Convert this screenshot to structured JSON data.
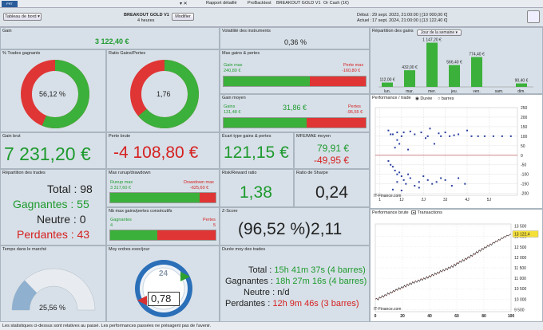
{
  "topbar": {
    "tab1": "Rapport détaillé",
    "tab2": "ProBacktest",
    "tab3": "BREAKOUT  GOLD V1",
    "tab4": "Or Cash (1€)"
  },
  "header": {
    "dropdown": "Tableau de bord",
    "strategy": "BREAKOUT  GOLD V1",
    "timeframe": "4 heures",
    "modify": "Modifier",
    "start_label": "Début :",
    "start_value": "29 sept. 2023, 21:00:00 | [10 000,00 €]",
    "end_label": "Actuel :",
    "end_value": "17 sept. 2024, 21:00:00 | [13 122,40 €]"
  },
  "gain": {
    "title": "Gain",
    "value": "3 122,40 €"
  },
  "volatility": {
    "title": "Volatilité des instruments",
    "value": "0,36 %"
  },
  "pct_winning": {
    "title": "% Trades gagnants",
    "value": "56,12 %",
    "fraction": 0.5612
  },
  "ratio_gl": {
    "title": "Ratio Gains/Pertes",
    "value": "1,76",
    "fraction": 0.6377
  },
  "max_gl": {
    "title": "Max gains & pertes",
    "gain_label": "Gain max",
    "gain_value": "240,80 €",
    "loss_label": "Perte max",
    "loss_value": "-160,80 €"
  },
  "avg_gain": {
    "title": "Gain moyen",
    "value": "31,86 €",
    "gains_label": "Gains",
    "gains_value": "131,48 €",
    "losses_label": "Pertes",
    "losses_value": "-95,55 €"
  },
  "gross_gain": {
    "title": "Gain brut",
    "value": "7 231,20 €"
  },
  "gross_loss": {
    "title": "Perte brute",
    "value": "-4 108,80 €"
  },
  "stddev": {
    "title": "Écart type gains & pertes",
    "value": "121,15 €"
  },
  "mfe": {
    "title": "MFE/MAE moyen",
    "mfe": "79,91 €",
    "mae": "-49,95 €"
  },
  "distribution": {
    "title": "Répartition des trades",
    "total_label": "Total : ",
    "total": "98",
    "win_label": "Gagnantes : ",
    "win": "55",
    "neutral_label": "Neutre : ",
    "neutral": "0",
    "lose_label": "Perdantes : ",
    "lose": "43"
  },
  "runup": {
    "title": "Max runup/drawdown",
    "runup_label": "Runup max",
    "runup_value": "3 317,60 €",
    "dd_label": "Drawdown max",
    "dd_value": "-625,60 €"
  },
  "rr": {
    "title": "Risk/Reward ratio",
    "value": "1,38"
  },
  "sharpe": {
    "title": "Ratio de Sharpe",
    "value": "0,24"
  },
  "consec": {
    "title": "Nb max gains/pertes consécutifs",
    "gains_label": "Gagnantes",
    "gains_value": "4",
    "losses_label": "Pertes",
    "losses_value": "5"
  },
  "zscore": {
    "title": "Z-Score",
    "value": "(96,52 %)2,11"
  },
  "time_market": {
    "title": "Temps dans le marché",
    "value": "25,56 %",
    "fraction": 0.2556
  },
  "avg_orders": {
    "title": "Moy ordres exec/jour",
    "value": "0,78",
    "clock": "24"
  },
  "avg_duration": {
    "title": "Durée moy des trades",
    "total_label": "Total : ",
    "total": "15h 41m 37s (4 barres)",
    "win_label": "Gagnantes : ",
    "win": "18h 27m 16s (4 barres)",
    "neutral_label": "Neutre : ",
    "neutral": "n/d",
    "lose_label": "Perdantes : ",
    "lose": "12h 9m 46s (3 barres)"
  },
  "gains_dist": {
    "title": "Répartition des gains",
    "period": "Jour de la semaine",
    "chart_data": {
      "type": "bar",
      "categories": [
        "lun.",
        "mar.",
        "mer.",
        "jeu.",
        "ven.",
        "sam.",
        "dim."
      ],
      "values": [
        112.0,
        432.0,
        1147.2,
        566.4,
        774.4,
        0,
        90.4
      ],
      "labels": [
        "112,00 €",
        "432,00 €",
        "1 147,20 €",
        "566,40 €",
        "774,40 €",
        "",
        "90,40 €"
      ]
    }
  },
  "perf_trade": {
    "title": "Performance / trade",
    "opt1": "Durée",
    "opt2": "barres",
    "watermark": "IT-Finance.com",
    "chart_data": {
      "type": "scatter",
      "xticks": [
        "1",
        "1J",
        "2J",
        "3J",
        "4J",
        "5J"
      ],
      "yticks": [
        "250",
        "200",
        "150",
        "100",
        "50",
        "0",
        "-50",
        "-100",
        "-150",
        "-200"
      ],
      "ylim": [
        -210,
        250
      ],
      "points": [
        [
          0.6,
          130
        ],
        [
          0.7,
          110
        ],
        [
          0.8,
          110
        ],
        [
          0.9,
          40
        ],
        [
          1.0,
          120
        ],
        [
          1.0,
          80
        ],
        [
          1.1,
          60
        ],
        [
          1.2,
          100
        ],
        [
          1.3,
          120
        ],
        [
          1.5,
          30
        ],
        [
          1.6,
          125
        ],
        [
          1.8,
          110
        ],
        [
          2.1,
          120
        ],
        [
          2.3,
          90
        ],
        [
          2.4,
          100
        ],
        [
          2.5,
          140
        ],
        [
          2.7,
          60
        ],
        [
          2.9,
          115
        ],
        [
          3.0,
          100
        ],
        [
          3.2,
          120
        ],
        [
          3.4,
          100
        ],
        [
          3.6,
          105
        ],
        [
          3.8,
          110
        ],
        [
          4.2,
          130
        ],
        [
          4.4,
          100
        ],
        [
          4.7,
          100
        ],
        [
          5.0,
          100
        ],
        [
          5.4,
          100
        ],
        [
          5.8,
          100
        ],
        [
          6.2,
          100
        ],
        [
          0.6,
          -30
        ],
        [
          0.7,
          -50
        ],
        [
          0.8,
          -60
        ],
        [
          0.9,
          -80
        ],
        [
          1.0,
          -100
        ],
        [
          1.0,
          -140
        ],
        [
          1.1,
          -90
        ],
        [
          1.2,
          -110
        ],
        [
          1.3,
          -130
        ],
        [
          1.4,
          -150
        ],
        [
          1.5,
          -100
        ],
        [
          1.6,
          -120
        ],
        [
          1.8,
          -160
        ],
        [
          2.0,
          -140
        ],
        [
          2.2,
          -110
        ],
        [
          2.4,
          -130
        ],
        [
          2.6,
          -150
        ],
        [
          2.8,
          -140
        ],
        [
          3.0,
          -120
        ],
        [
          3.2,
          -130
        ],
        [
          3.5,
          -160
        ],
        [
          3.8,
          -120
        ],
        [
          4.1,
          -150
        ],
        [
          0.8,
          -180
        ],
        [
          1.2,
          -185
        ],
        [
          2.0,
          -170
        ]
      ]
    }
  },
  "perf_gross": {
    "title": "Performance brute",
    "mode": "Transactions",
    "last_value": "13 122,4",
    "watermark": "IT-Finance.com",
    "chart_data": {
      "type": "line",
      "xticks": [
        "0",
        "20",
        "40",
        "60",
        "80",
        "100"
      ],
      "yticks": [
        "13 500",
        "13 000",
        "12 500",
        "12 000",
        "11 500",
        "11 000",
        "10 500",
        "10 000",
        "9 500"
      ],
      "xlim": [
        0,
        100
      ],
      "ylim": [
        9400,
        13600
      ],
      "values": [
        10000,
        10040,
        9960,
        10100,
        10050,
        10170,
        10090,
        10220,
        10160,
        10300,
        10230,
        10350,
        10290,
        10420,
        10360,
        10480,
        10420,
        10550,
        10470,
        10600,
        10530,
        10660,
        10580,
        10720,
        10650,
        10780,
        10700,
        10830,
        10760,
        10880,
        10800,
        10920,
        10850,
        10980,
        10900,
        11020,
        10950,
        11080,
        11000,
        11130,
        11060,
        11190,
        11120,
        11250,
        11180,
        11300,
        11230,
        11370,
        11300,
        11420,
        11350,
        11480,
        11400,
        11540,
        11470,
        11600,
        11520,
        11680,
        11600,
        11750,
        11690,
        11820,
        11760,
        11900,
        11820,
        11960,
        11900,
        12030,
        11970,
        12110,
        12050,
        12200,
        12130,
        12280,
        12210,
        12350,
        12290,
        12430,
        12380,
        12500,
        12450,
        12580,
        12520,
        12650,
        12590,
        12720,
        12680,
        12790,
        12750,
        12860,
        12820,
        12930,
        12900,
        13000,
        12970,
        13060,
        13030,
        13090,
        13122
      ]
    }
  },
  "footer": "Les statistiques ci-dessus sont relatives au passé. Les performances passées ne présagent pas de l'avenir."
}
